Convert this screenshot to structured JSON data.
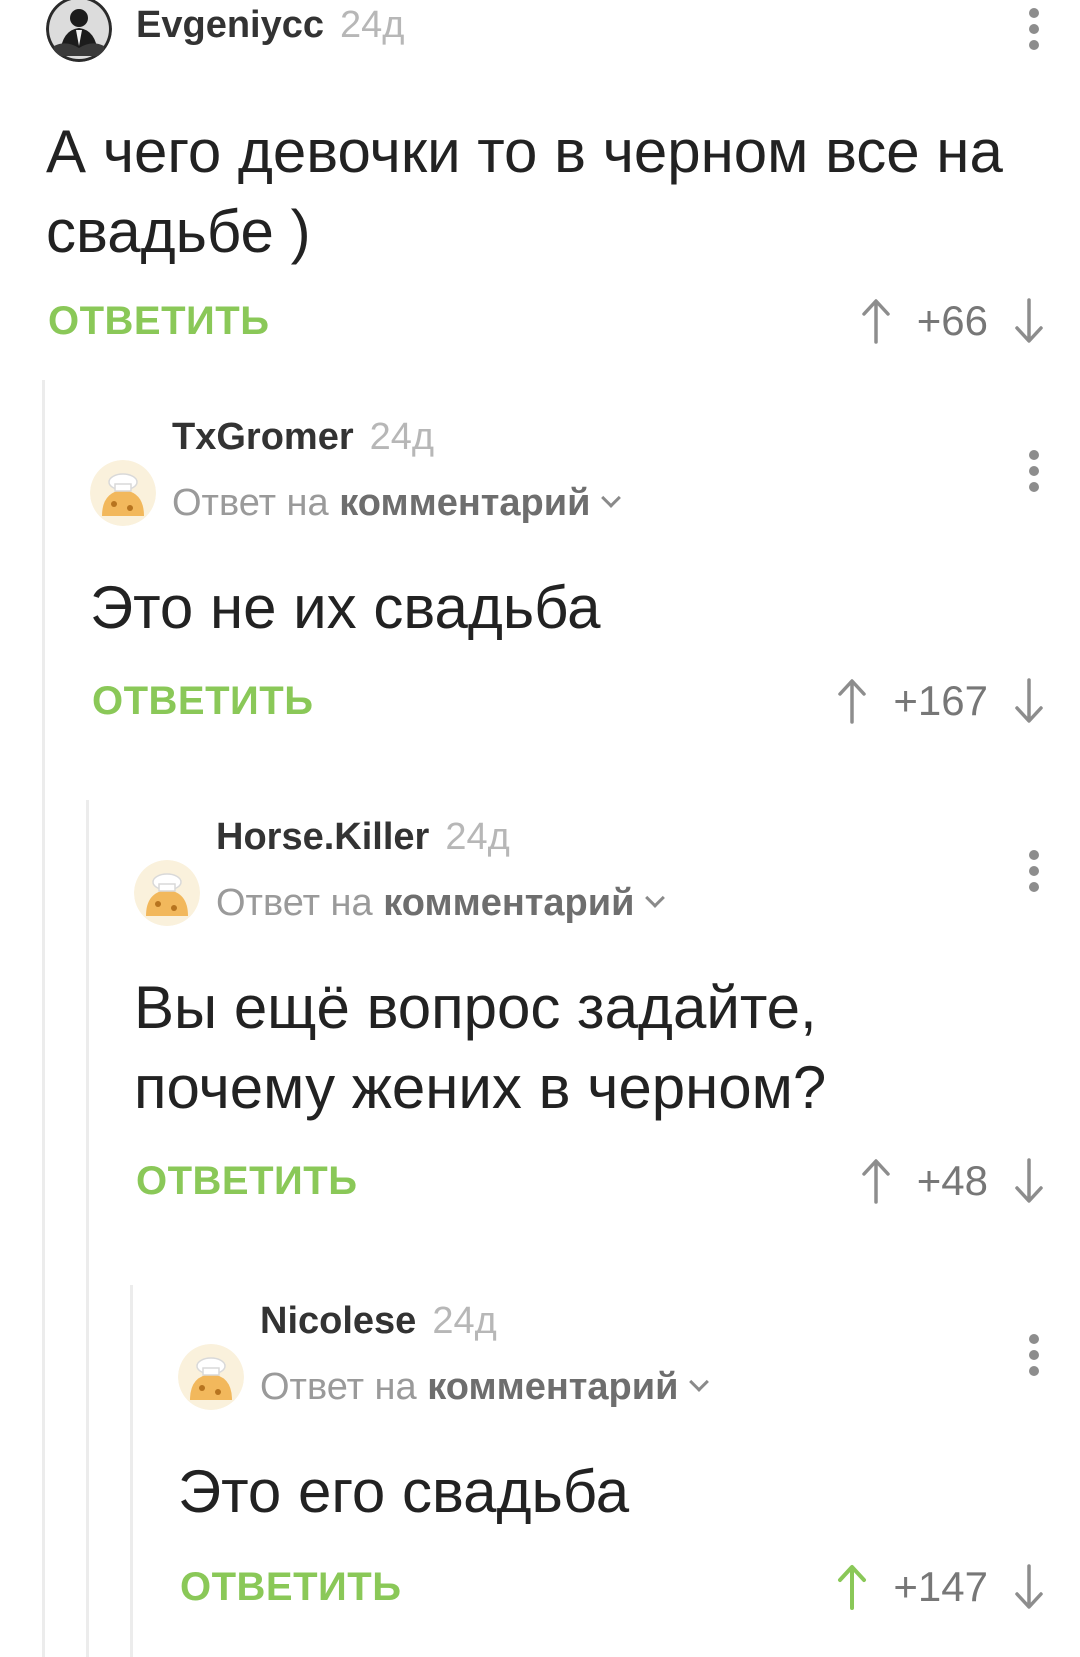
{
  "comments": [
    {
      "username": "Evgeniycc",
      "time": "24д",
      "reply_prefix": "",
      "reply_ref": "",
      "text_lines": [
        "А чего девочки то в черном все на",
        "свадьбе )"
      ],
      "reply_label": "ОТВЕТИТЬ",
      "rating": "+66",
      "upvoted": false
    },
    {
      "username": "TxGromer",
      "time": "24д",
      "reply_prefix": "Ответ на",
      "reply_ref": "комментарий",
      "text_lines": [
        "Это не их свадьба"
      ],
      "reply_label": "ОТВЕТИТЬ",
      "rating": "+167",
      "upvoted": false
    },
    {
      "username": "Horse.Killer",
      "time": "24д",
      "reply_prefix": "Ответ на",
      "reply_ref": "комментарий",
      "text_lines": [
        "Вы ещё вопрос задайте,",
        "почему жених в черном?"
      ],
      "reply_label": "ОТВЕТИТЬ",
      "rating": "+48",
      "upvoted": false
    },
    {
      "username": "Nicolese",
      "time": "24д",
      "reply_prefix": "Ответ на",
      "reply_ref": "комментарий",
      "text_lines": [
        "Это его свадьба"
      ],
      "reply_label": "ОТВЕТИТЬ",
      "rating": "+147",
      "upvoted": true
    }
  ],
  "icons": {
    "avatar_default": "chef-cookie-avatar-icon",
    "avatar_user": "user-photo-avatar-icon",
    "menu": "more-vertical-icon",
    "upvote": "arrow-up-icon",
    "downvote": "arrow-down-icon",
    "reply_chevron": "chevron-down-icon"
  },
  "colors": {
    "accent_green": "#8ac858",
    "thread_line": "#ececec",
    "vote_arrow": "#8d8d8d"
  }
}
